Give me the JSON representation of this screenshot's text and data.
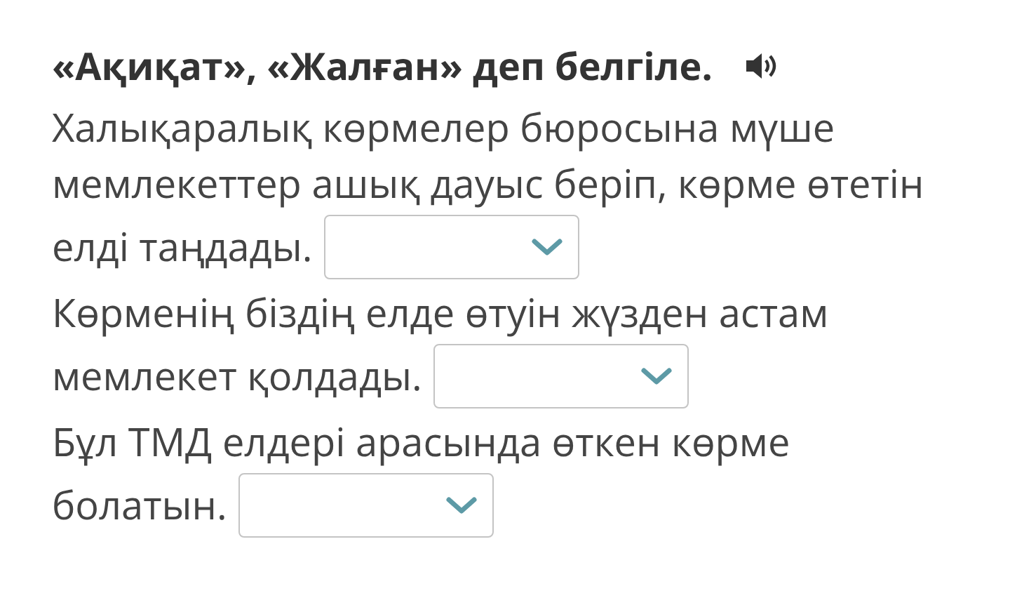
{
  "title": "«Ақиқат», «Жалған» деп белгіле.",
  "questions": [
    {
      "lines": [
        "Халықаралық көрмелер бюросына мүше",
        "мемлекеттер ашық дауыс беріп, көрме өтетін",
        "елді таңдады."
      ],
      "answer": {
        "kind": "dropdown"
      }
    },
    {
      "lines": [
        "Көрменің біздің елде өтуін жүзден астам",
        "мемлекет қолдады."
      ],
      "answer": {
        "kind": "dropdown"
      }
    },
    {
      "lines": [
        "Бұл ТМД елдері арасында өткен көрме",
        "болатын."
      ],
      "answer": {
        "kind": "dropdown"
      }
    }
  ]
}
